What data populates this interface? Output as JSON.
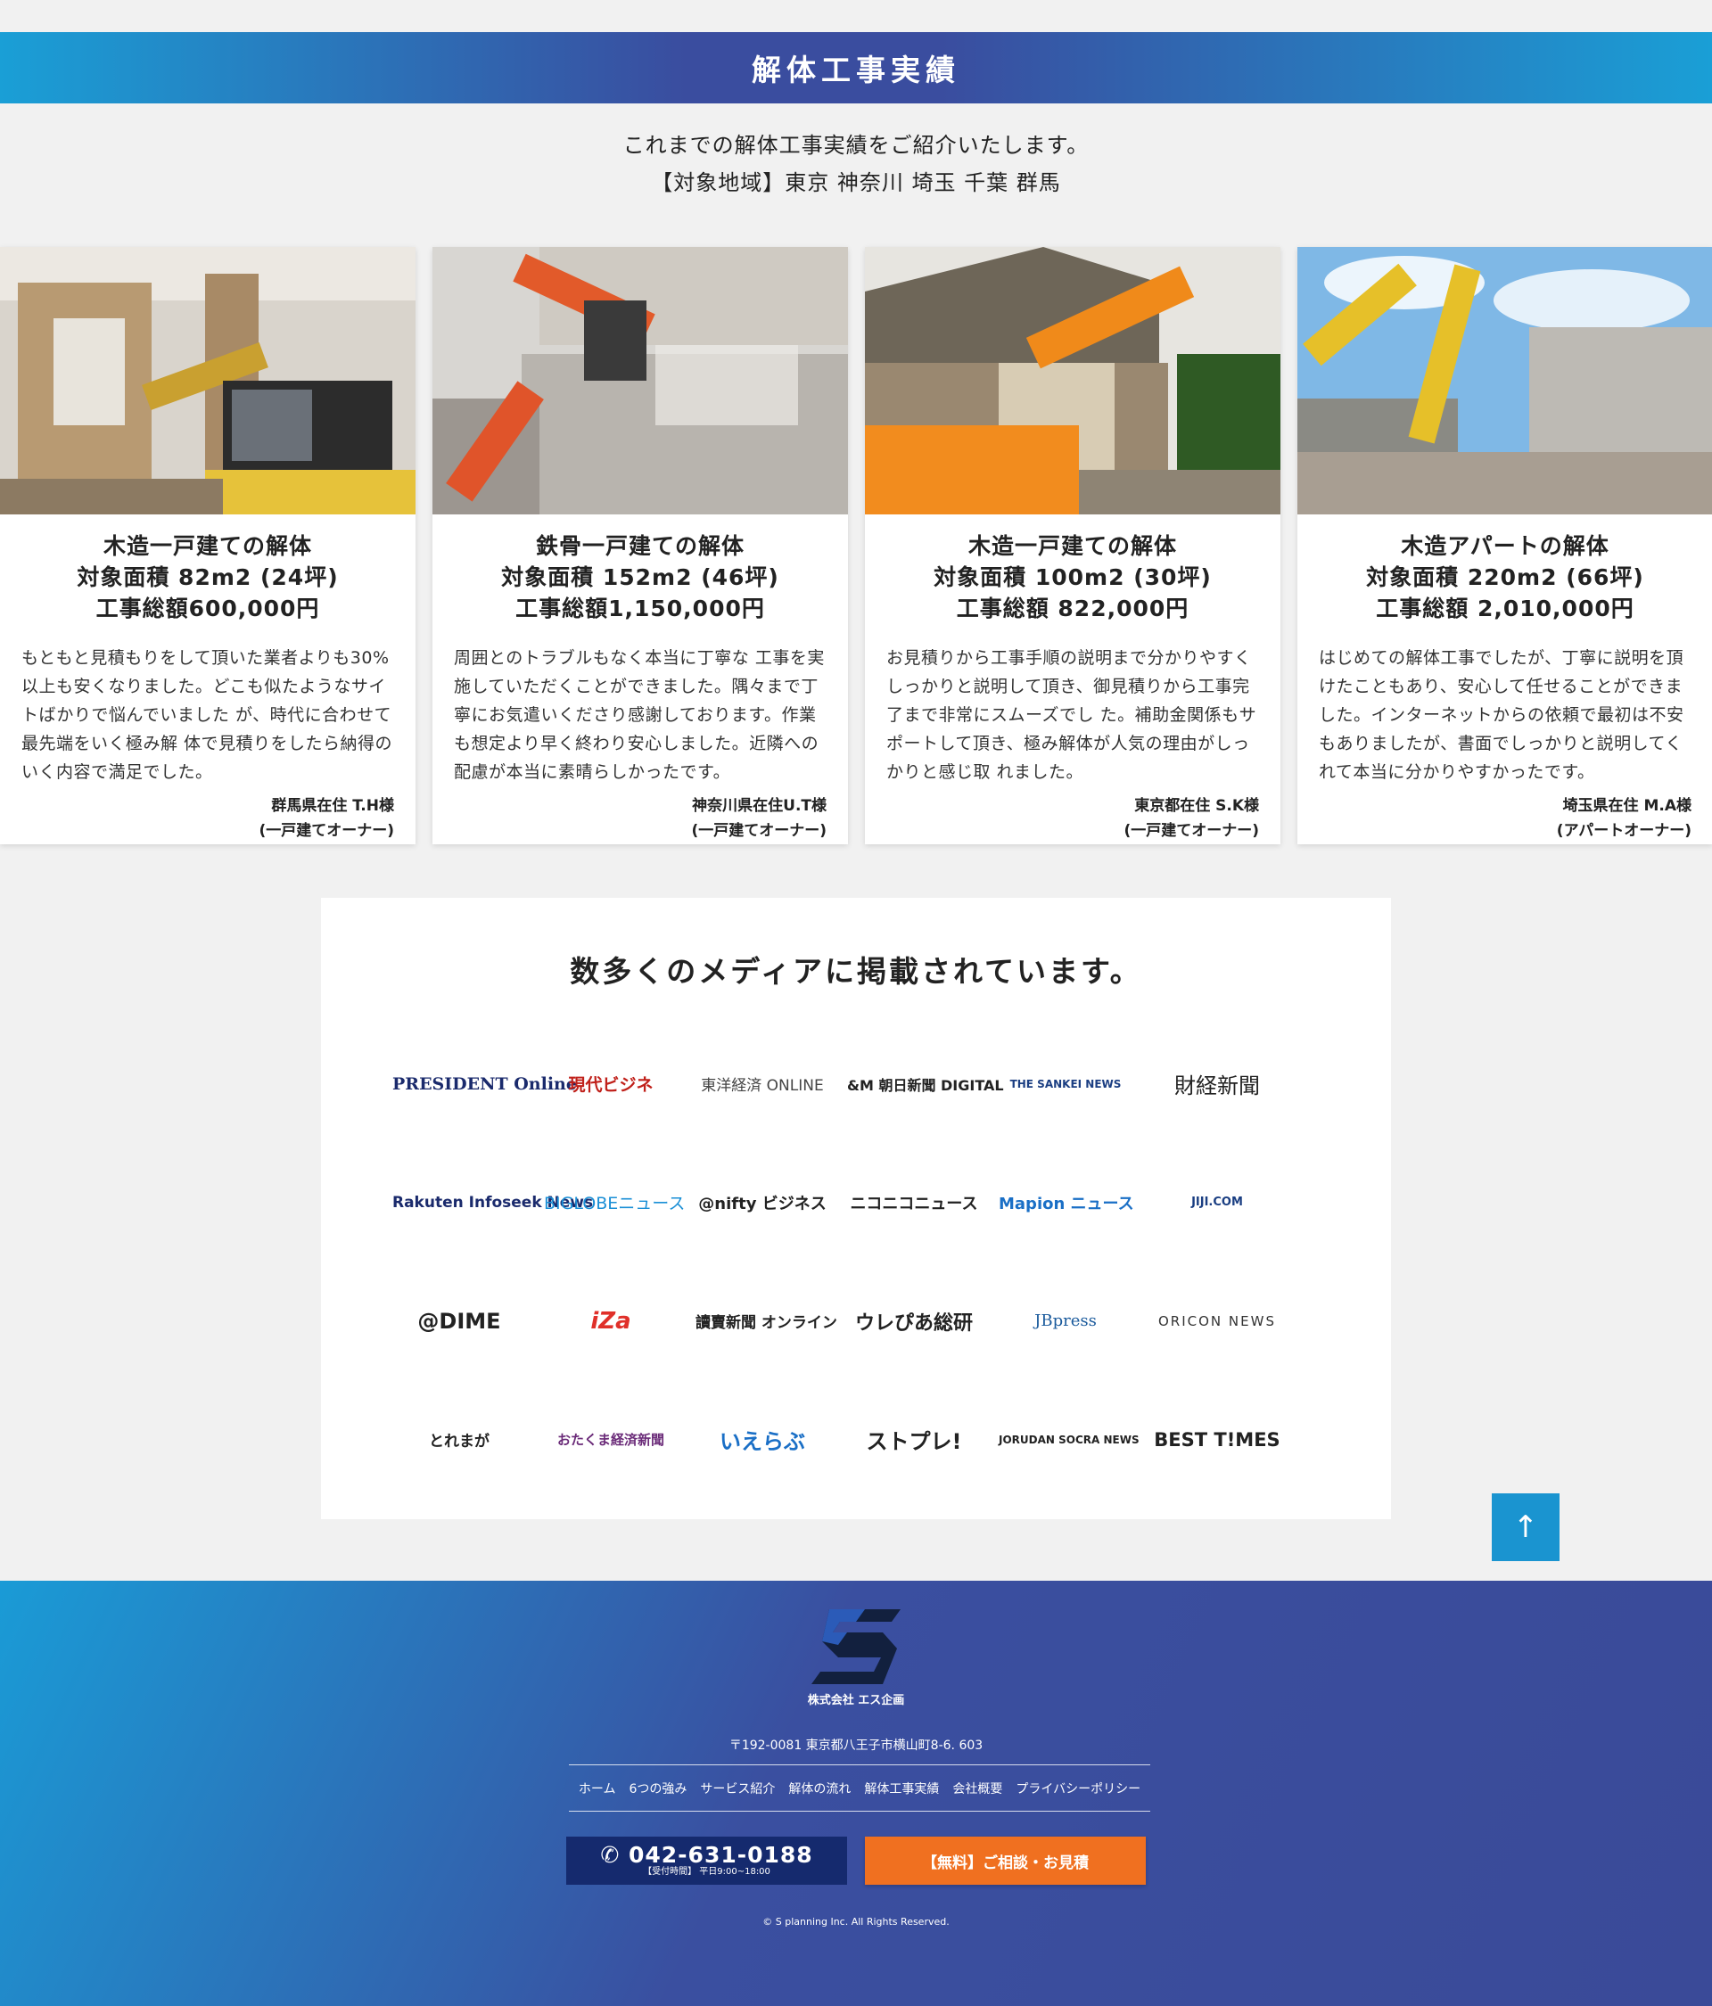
{
  "section": {
    "title": "解体工事実績",
    "intro_line1": "これまでの解体工事実績をご紹介いたします。",
    "intro_line2": "【対象地域】東京 神奈川 埼玉 千葉 群馬"
  },
  "cards": [
    {
      "title1": "木造一戸建ての解体",
      "title2": "対象面積 82m2 (24坪)",
      "title3": "工事総額600,000円",
      "body": "もともと見積もりをして頂いた業者よりも30%以上も安くなりました。どこも似たようなサイトばかりで悩んでいました が、時代に合わせて最先端をいく極み解 体で見積りをしたら納得のいく内容で満足でした。",
      "owner1": "群馬県在住 T.H様",
      "owner2": "(一戸建てオーナー)"
    },
    {
      "title1": "鉄骨一戸建ての解体",
      "title2": "対象面積 152m2 (46坪)",
      "title3": "工事総額1,150,000円",
      "body": "周囲とのトラブルもなく本当に丁寧な 工事を実施していただくことができました。隅々まで丁寧にお気遣いくださり感謝しております。作業も想定より早く終わり安心しました。近隣への配慮が本当に素晴らしかったです。",
      "owner1": "神奈川県在住U.T様",
      "owner2": "(一戸建てオーナー)"
    },
    {
      "title1": "木造一戸建ての解体",
      "title2": "対象面積 100m2 (30坪)",
      "title3": "工事総額 822,000円",
      "body": "お見積りから工事手順の説明まで分かりやすくしっかりと説明して頂き、御見積りから工事完了まで非常にスムーズでし た。補助金関係もサポートして頂き、極み解体が人気の理由がしっかりと感じ取 れました。",
      "owner1": "東京都在住 S.K様",
      "owner2": "(一戸建てオーナー)"
    },
    {
      "title1": "木造アパートの解体",
      "title2": "対象面積 220m2 (66坪)",
      "title3": "工事総額 2,010,000円",
      "body": "はじめての解体工事でしたが、丁寧に説明を頂けたこともあり、安心して任せることができました。インターネットからの依頼で最初は不安もありましたが、書面でしっかりと説明してくれて本当に分かりやすかったです。",
      "owner1": "埼玉県在住 M.A様",
      "owner2": "(アパートオーナー)"
    }
  ],
  "media": {
    "title": "数多くのメディアに掲載されています。",
    "rows": [
      [
        "PRESIDENT Online",
        "現代ビジネ",
        "東洋経済 ONLINE",
        "&M 朝日新聞 DIGITAL",
        "THE SANKEI NEWS",
        "財経新聞"
      ],
      [
        "Rakuten Infoseek News",
        "BIGLOBEニュース",
        "@nifty ビジネス",
        "ニコニコニュース",
        "Mapion ニュース",
        "JIJI.COM"
      ],
      [
        "@DIME",
        "iZa",
        "讀賣新聞 オンライン",
        "ウレぴあ総研",
        "JBpress",
        "ORICON NEWS"
      ],
      [
        "とれまが",
        "おたくま経済新聞",
        "いえらぶ",
        "ストプレ!",
        "JORUDAN SOCRA NEWS",
        "BEST T!MES"
      ]
    ]
  },
  "to_top": "↑",
  "footer": {
    "company": "株式会社 エス企画",
    "address": "〒192-0081 東京都八王子市横山町8-6. 603",
    "nav": [
      "ホーム",
      "6つの強み",
      "サービス紹介",
      "解体の流れ",
      "解体工事実績",
      "会社概要",
      "プライバシーポリシー"
    ],
    "tel": "042-631-0188",
    "hours": "【受付時間】 平日9:00~18:00",
    "consult": "【無料】ご相談・お見積",
    "copyright": "© S planning Inc. All Rights Reserved."
  }
}
